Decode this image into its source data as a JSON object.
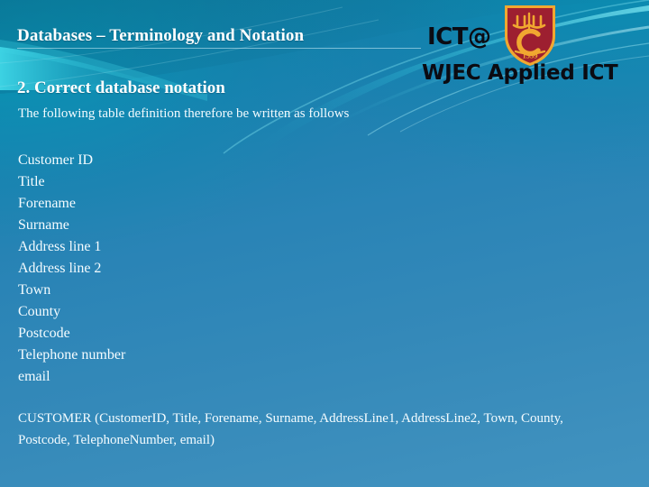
{
  "slide": {
    "title": "Databases – Terminology and Notation",
    "section_heading": "2. Correct database notation",
    "intro": "The following table definition therefore be written as follows",
    "fields": [
      "Customer ID",
      "Title",
      "Forename",
      "Surname",
      "Address line 1",
      "Address line 2",
      "Town",
      "County",
      "Postcode",
      "Telephone number",
      "email"
    ],
    "notation": "CUSTOMER (CustomerID, Title, Forename, Surname, AddressLine1, AddressLine2, Town, County, Postcode, TelephoneNumber, email)"
  },
  "logo": {
    "ict_text": "ICT@",
    "wjec_text": "WJEC Applied ICT",
    "crest_year": "1539",
    "crest_icon": "school-shield-crest-icon"
  },
  "colors": {
    "background_top_left": "#0d7b9b",
    "background_bottom_right": "#4193c0",
    "swoosh_cyan": "#29c6dd",
    "text_white": "#ffffff",
    "logo_black": "#0b0b12",
    "crest_red": "#a01f2e",
    "crest_gold": "#f0a830"
  }
}
